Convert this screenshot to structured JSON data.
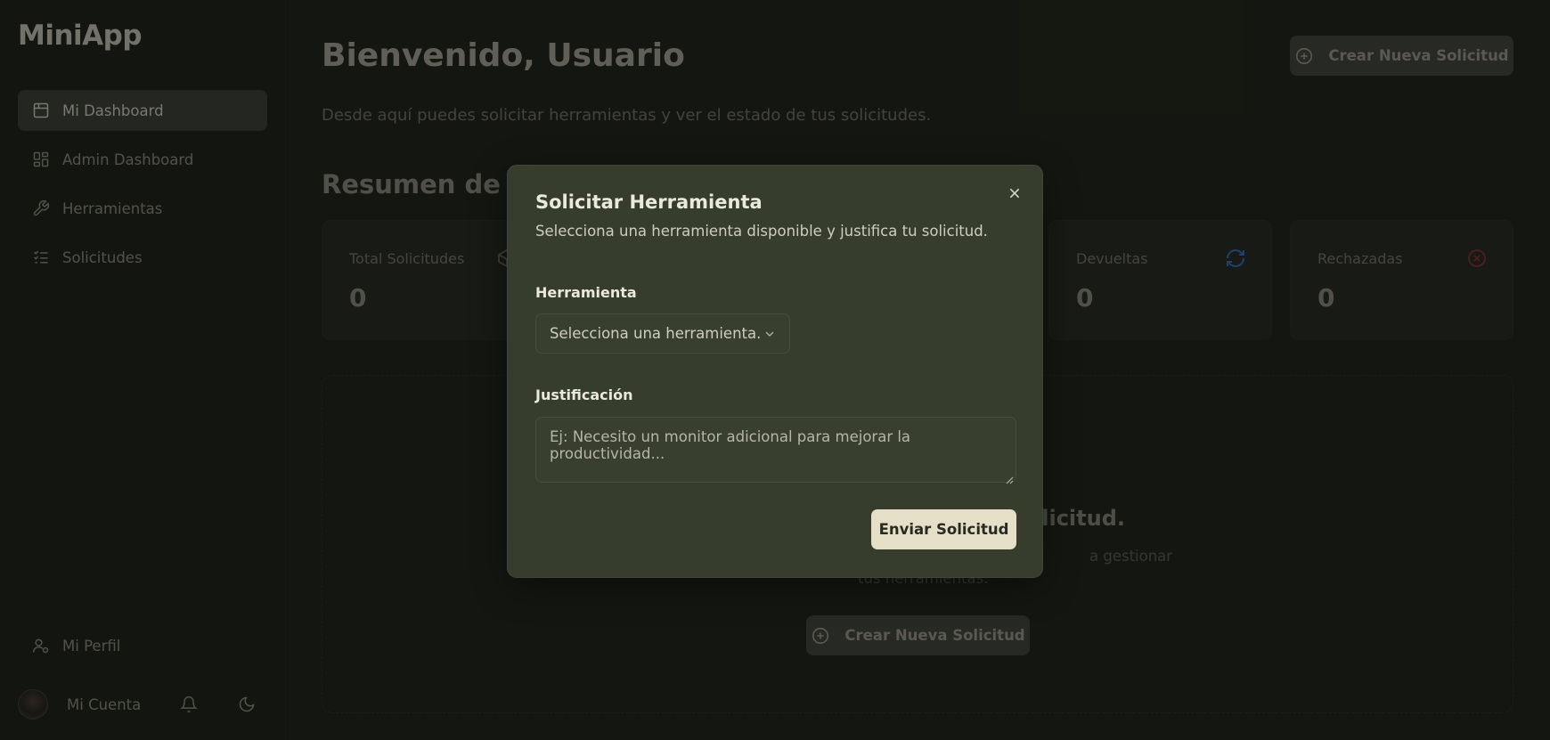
{
  "app": {
    "name": "MiniApp"
  },
  "sidebar": {
    "items": [
      {
        "label": "Mi Dashboard",
        "icon": "calendar-icon",
        "active": true
      },
      {
        "label": "Admin Dashboard",
        "icon": "grid-icon",
        "active": false
      },
      {
        "label": "Herramientas",
        "icon": "wrench-icon",
        "active": false
      },
      {
        "label": "Solicitudes",
        "icon": "list-check-icon",
        "active": false
      }
    ],
    "profile_label": "Mi Perfil",
    "account_label": "Mi Cuenta"
  },
  "header": {
    "title": "Bienvenido, Usuario",
    "subtitle": "Desde aquí puedes solicitar herramientas y ver el estado de tus solicitudes.",
    "new_request_label": "Crear Nueva Solicitud"
  },
  "summary": {
    "title": "Resumen de mi",
    "cards": [
      {
        "label": "Total Solicitudes",
        "value": "0",
        "icon": "box-icon"
      },
      {
        "label": "Devueltas",
        "value": "0",
        "icon": "refresh-icon",
        "color": "#3a7bd5"
      },
      {
        "label": "Rechazadas",
        "value": "0",
        "icon": "x-circle-icon",
        "color": "#b23a3a"
      }
    ]
  },
  "empty_state": {
    "title": "olicitud.",
    "desc_line1": "a gestionar",
    "desc_line2": "tus herramientas.",
    "button_label": "Crear Nueva Solicitud"
  },
  "modal": {
    "title": "Solicitar Herramienta",
    "description": "Selecciona una herramienta disponible y justifica tu solicitud.",
    "tool_label": "Herramienta",
    "tool_placeholder": "Selecciona una herramienta...",
    "justification_label": "Justificación",
    "justification_placeholder": "Ej: Necesito un monitor adicional para mejorar la productividad...",
    "submit_label": "Enviar Solicitud"
  },
  "colors": {
    "background": "#1d2119",
    "modal": "#363d2c",
    "accent_button": "#e5dfc8"
  }
}
